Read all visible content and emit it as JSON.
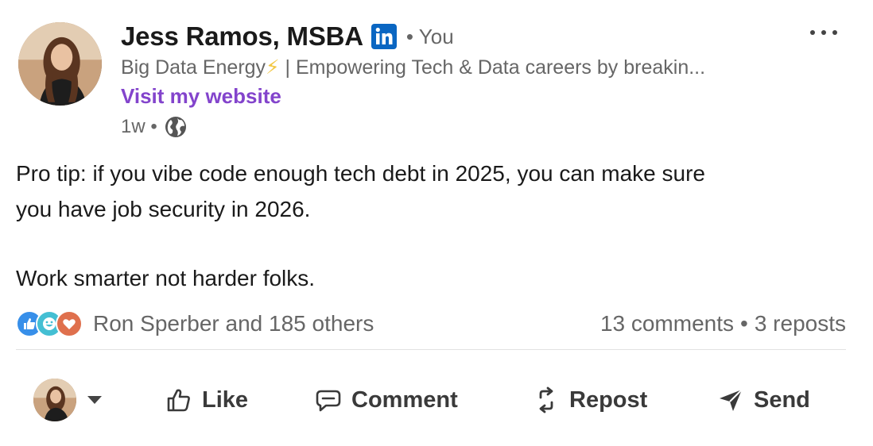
{
  "author": {
    "name": "Jess Ramos, MSBA",
    "badge_icon": "linkedin-icon",
    "relation": "• You",
    "headline_pre": "Big Data Energy",
    "headline_bolt": "⚡",
    "headline_post": " | Empowering Tech & Data careers by breakin...",
    "website_label": "Visit my website",
    "age": "1w •",
    "visibility_icon": "globe-icon"
  },
  "post": {
    "line1": "Pro tip: if you vibe code enough tech debt in 2025, you can make sure",
    "line2": "you have job security in 2026.",
    "line3": "Work smarter not harder folks."
  },
  "social": {
    "reactions_text": "Ron Sperber and 185 others",
    "reaction_icons": [
      "like-icon",
      "funny-icon",
      "love-icon"
    ],
    "comments": "13 comments",
    "separator": "•",
    "reposts": "3 reposts"
  },
  "actions": {
    "like": "Like",
    "comment": "Comment",
    "repost": "Repost",
    "send": "Send"
  },
  "colors": {
    "linkedin_blue": "#0a66c2",
    "link_purple": "#8344cc",
    "like_blue": "#378fe9",
    "funny_teal": "#44bfd3",
    "love_orange": "#df704d"
  },
  "more_menu_icon": "ellipsis-icon"
}
